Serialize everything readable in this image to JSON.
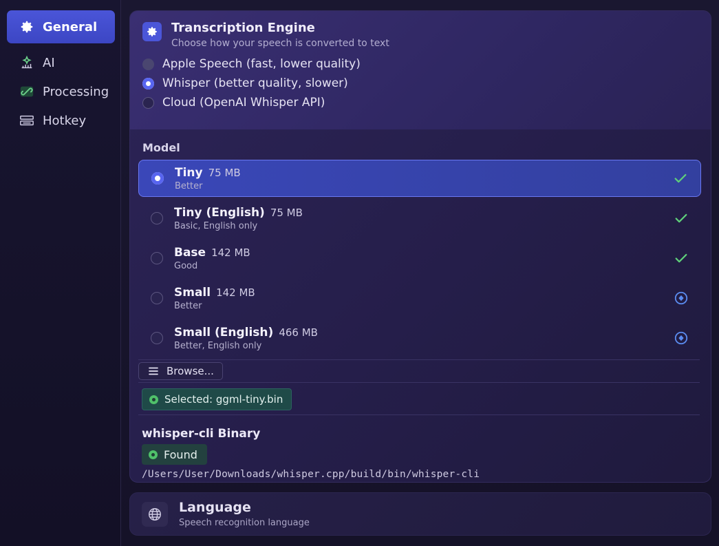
{
  "sidebar": {
    "items": [
      {
        "label": "General",
        "icon": "gear-icon",
        "active": true
      },
      {
        "label": "AI",
        "icon": "ai-sparkle-icon",
        "active": false
      },
      {
        "label": "Processing",
        "icon": "link-icon",
        "active": false
      },
      {
        "label": "Hotkey",
        "icon": "keyboard-icon",
        "active": false
      }
    ]
  },
  "engine": {
    "title": "Transcription Engine",
    "subtitle": "Choose how your speech is converted to text",
    "options": [
      {
        "label": "Apple Speech (fast, lower quality)",
        "selected": false
      },
      {
        "label": "Whisper (better quality, slower)",
        "selected": true
      },
      {
        "label": "Cloud (OpenAI Whisper API)",
        "selected": false
      }
    ]
  },
  "model": {
    "label": "Model",
    "items": [
      {
        "name": "Tiny",
        "size": "75 MB",
        "desc": "Better",
        "selected": true,
        "status": "downloaded"
      },
      {
        "name": "Tiny (English)",
        "size": "75 MB",
        "desc": "Basic, English only",
        "selected": false,
        "status": "downloaded"
      },
      {
        "name": "Base",
        "size": "142 MB",
        "desc": "Good",
        "selected": false,
        "status": "downloaded"
      },
      {
        "name": "Small",
        "size": "142 MB",
        "desc": "Better",
        "selected": false,
        "status": "download"
      },
      {
        "name": "Small (English)",
        "size": "466 MB",
        "desc": "Better, English only",
        "selected": false,
        "status": "download"
      }
    ],
    "browse_label": "Browse...",
    "selected_label": "Selected: ggml-tiny.bin"
  },
  "binary": {
    "title": "whisper-cli Binary",
    "status": "Found",
    "path": "/Users/User/Downloads/whisper.cpp/build/bin/whisper-cli"
  },
  "language": {
    "title": "Language",
    "subtitle": "Speech recognition language"
  },
  "colors": {
    "accent": "#4b56d9",
    "check": "#5fd07a",
    "download": "#5b8cf0",
    "found": "#4fc06a"
  }
}
